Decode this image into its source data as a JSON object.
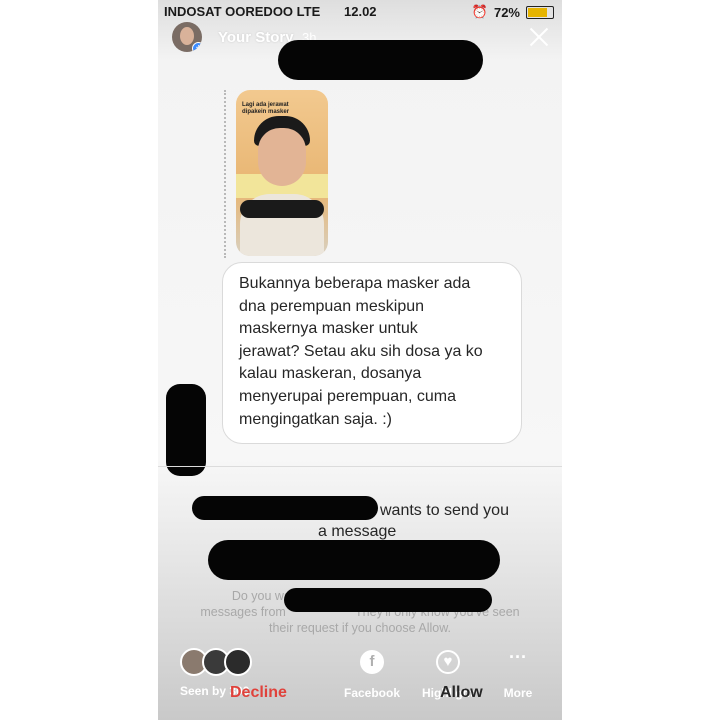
{
  "status_bar": {
    "carrier": "INDOSAT OOREDOO  LTE",
    "time": "12.02",
    "battery_percent": "72%",
    "battery_level": 0.72
  },
  "story": {
    "title": "Your Story",
    "time_ago": "3h"
  },
  "reply_message": "Bukannya beberapa masker ada\ndna perempuan meskipun\nmaskernya masker untuk\njerawat? Setau aku sih dosa ya ko\nkalau maskeran, dosanya\nmenyerupai perempuan, cuma\nmengingatkan saja. :)",
  "story_thumbnail_caption": "Lagi ada jerawat\ndipakein masker",
  "request": {
    "line1": "wants to send you",
    "line2": "a message",
    "faint_line1": "Do you want                                                you",
    "faint_line2": "messages from                    They'll only know you've seen",
    "faint_line3": "their request if you choose Allow.",
    "decline_label": "Decline",
    "allow_label": "Allow"
  },
  "bottom_bar": {
    "seen_by": "Seen by 300",
    "facebook_label": "Facebook",
    "highlight_label": "Highlight",
    "more_label": "More"
  },
  "colors": {
    "decline": "#e0423b",
    "accent_blue": "#3d8bfd"
  }
}
